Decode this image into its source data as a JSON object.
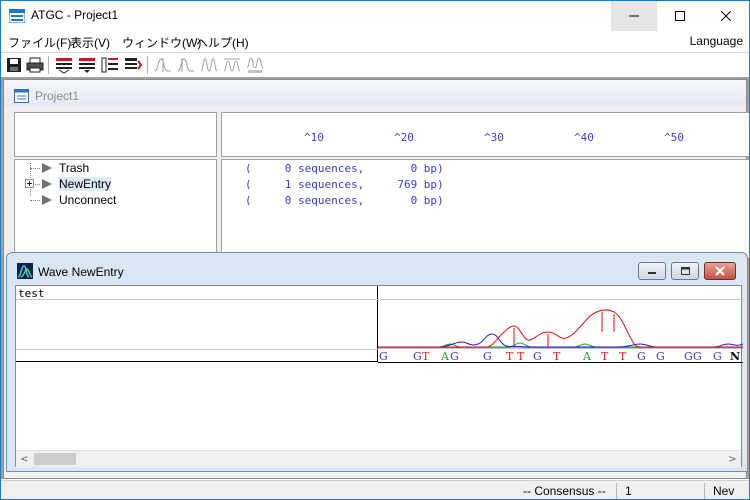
{
  "window": {
    "title": "ATGC - Project1",
    "minimize_glyph": "—",
    "maximize_glyph": "☐",
    "close_glyph": "✕"
  },
  "menu": {
    "file": "ファイル(F)",
    "view": "表示(V)",
    "window": "ウィンドウ(W)",
    "help": "ヘルプ(H)",
    "language": "Language"
  },
  "toolbar": {
    "icons": [
      "save-icon",
      "print-icon",
      "assemble-icon",
      "assemble-alt-icon",
      "align-icon",
      "export-icon",
      "wave-icon-1",
      "wave-icon-2",
      "wave-icon-3",
      "wave-icon-4",
      "wave-reset-icon"
    ]
  },
  "project": {
    "title": "Project1",
    "ruler": [
      "^10",
      "^20",
      "^30",
      "^40",
      "^50"
    ],
    "tree": [
      {
        "label": "Trash"
      },
      {
        "label": "NewEntry"
      },
      {
        "label": "Unconnect"
      }
    ],
    "sequences": [
      "(     0 sequences,       0 bp)",
      "(     1 sequences,     769 bp)",
      "(     0 sequences,       0 bp)"
    ]
  },
  "wave": {
    "title": "Wave NewEntry",
    "track_label": "test",
    "bases": [
      {
        "b": "G",
        "c": "#4040c0"
      },
      {
        "b": "G",
        "c": "#4040c0"
      },
      {
        "b": "T",
        "c": "#e02020"
      },
      {
        "b": "A",
        "c": "#2a9a2a"
      },
      {
        "b": "G",
        "c": "#4040c0"
      },
      {
        "b": "G",
        "c": "#4040c0"
      },
      {
        "b": "T",
        "c": "#e02020"
      },
      {
        "b": "T",
        "c": "#e02020"
      },
      {
        "b": "G",
        "c": "#4040c0"
      },
      {
        "b": "T",
        "c": "#e02020"
      },
      {
        "b": "A",
        "c": "#2a9a2a"
      },
      {
        "b": "T",
        "c": "#e02020"
      },
      {
        "b": "T",
        "c": "#e02020"
      },
      {
        "b": "G",
        "c": "#4040c0"
      },
      {
        "b": "G",
        "c": "#4040c0"
      },
      {
        "b": "G",
        "c": "#4040c0"
      },
      {
        "b": "G",
        "c": "#4040c0"
      },
      {
        "b": "G",
        "c": "#4040c0"
      },
      {
        "b": "N",
        "c": "#000000"
      }
    ],
    "scroll_left": "<",
    "scroll_right": ">"
  },
  "status": {
    "consensus": "-- Consensus --",
    "position": "1",
    "mode": "Nev"
  }
}
